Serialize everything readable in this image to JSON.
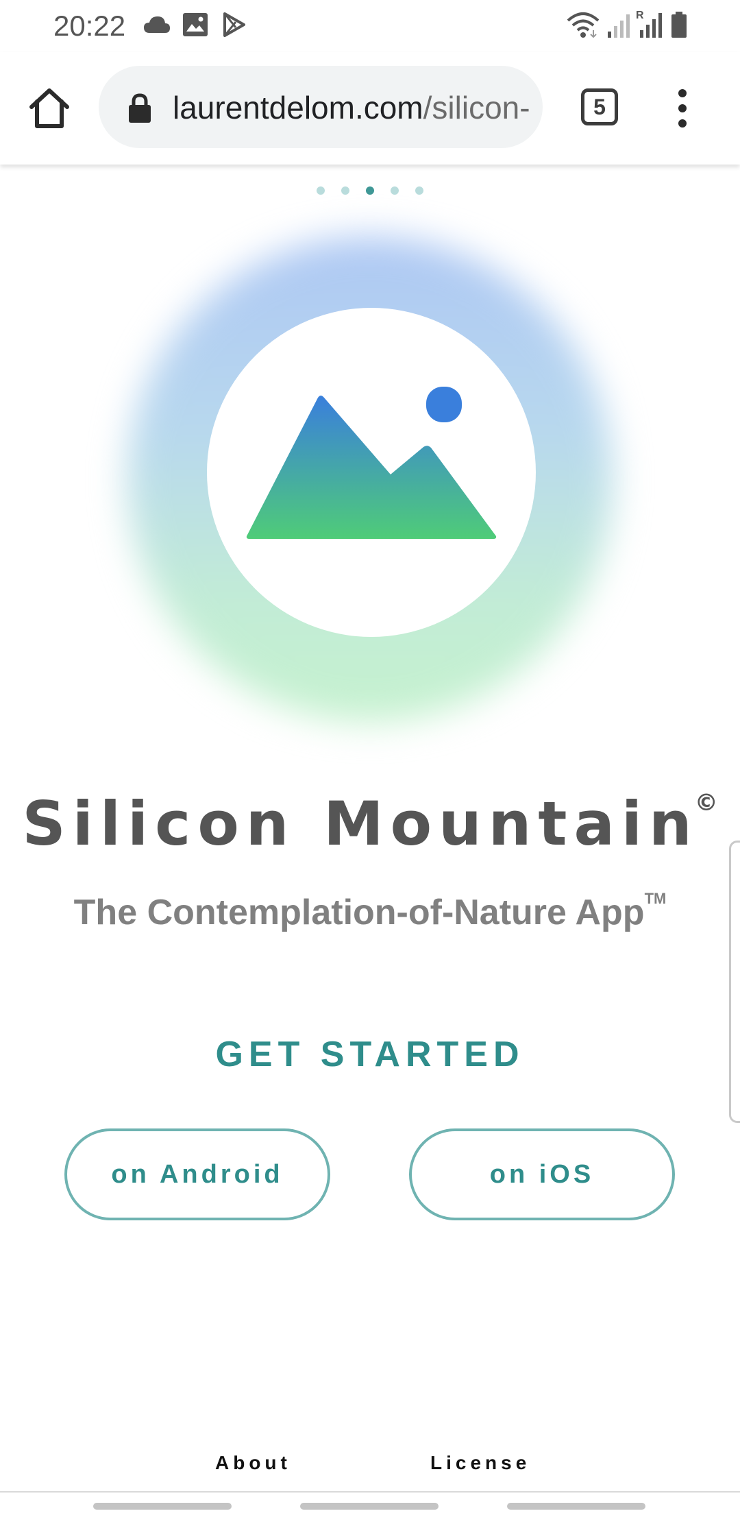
{
  "status_bar": {
    "time": "20:22",
    "left_icons": [
      "cloud-icon",
      "image-icon",
      "play-store-icon"
    ],
    "right_icons": [
      "wifi-icon",
      "signal-icon",
      "roaming-signal-icon",
      "battery-icon"
    ],
    "roaming_label": "R"
  },
  "browser": {
    "url_host": "laurentdelom.com",
    "url_path": "/silicon-mountain",
    "tab_count": "5",
    "icons": [
      "home-icon",
      "lock-icon",
      "tabs-icon",
      "more-vert-icon"
    ]
  },
  "carousel": {
    "dots_count": 5,
    "active_index": 2
  },
  "logo": {
    "icon": "mountain-sun-icon",
    "gradient_top": "#3a7fdc",
    "gradient_bottom": "#4fcc78",
    "sun_color": "#3a7fdc"
  },
  "hero": {
    "title": "Silicon Mountain",
    "title_mark": "©",
    "subtitle": "The Contemplation-of-Nature App",
    "subtitle_mark": "TM"
  },
  "cta": {
    "heading": "GET STARTED",
    "android_label": "on Android",
    "ios_label": "on iOS"
  },
  "footer": {
    "about_label": "About",
    "license_label": "License"
  },
  "colors": {
    "accent": "#2f8d8b",
    "button_border": "#6fb3b1",
    "title_gray": "#555555",
    "subtitle_gray": "#808080"
  }
}
